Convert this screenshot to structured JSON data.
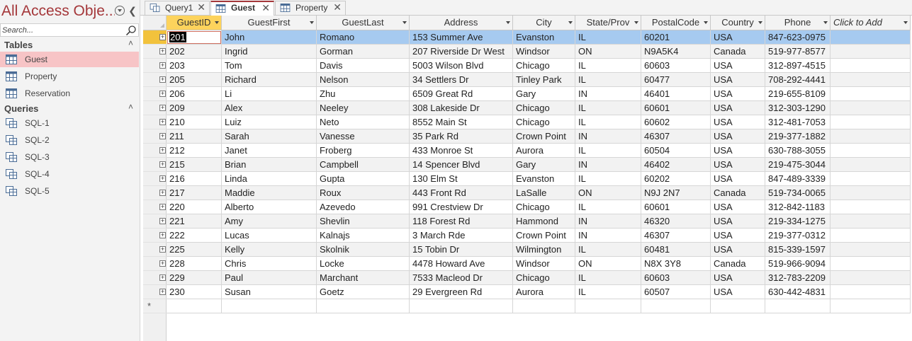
{
  "nav": {
    "title": "All Access Obje...",
    "search_placeholder": "Search...",
    "groups": [
      {
        "label": "Tables",
        "items": [
          {
            "label": "Guest"
          },
          {
            "label": "Property"
          },
          {
            "label": "Reservation"
          }
        ]
      },
      {
        "label": "Queries",
        "items": [
          {
            "label": "SQL-1"
          },
          {
            "label": "SQL-2"
          },
          {
            "label": "SQL-3"
          },
          {
            "label": "SQL-4"
          },
          {
            "label": "SQL-5"
          }
        ]
      }
    ]
  },
  "tabs": [
    {
      "label": "Query1"
    },
    {
      "label": "Guest"
    },
    {
      "label": "Property"
    }
  ],
  "columns": [
    "GuestID",
    "GuestFirst",
    "GuestLast",
    "Address",
    "City",
    "State/Prov",
    "PostalCode",
    "Country",
    "Phone",
    "Click to Add"
  ],
  "rows": [
    [
      "201",
      "John",
      "Romano",
      "153 Summer Ave",
      "Evanston",
      "IL",
      "60201",
      "USA",
      "847-623-0975"
    ],
    [
      "202",
      "Ingrid",
      "Gorman",
      "207 Riverside Dr West",
      "Windsor",
      "ON",
      "N9A5K4",
      "Canada",
      "519-977-8577"
    ],
    [
      "203",
      "Tom",
      "Davis",
      "5003 Wilson Blvd",
      "Chicago",
      "IL",
      "60603",
      "USA",
      "312-897-4515"
    ],
    [
      "205",
      "Richard",
      "Nelson",
      "34 Settlers Dr",
      "Tinley Park",
      "IL",
      "60477",
      "USA",
      "708-292-4441"
    ],
    [
      "206",
      "Li",
      "Zhu",
      "6509 Great Rd",
      "Gary",
      "IN",
      "46401",
      "USA",
      "219-655-8109"
    ],
    [
      "209",
      "Alex",
      "Neeley",
      "308 Lakeside Dr",
      "Chicago",
      "IL",
      "60601",
      "USA",
      "312-303-1290"
    ],
    [
      "210",
      "Luiz",
      "Neto",
      "8552 Main St",
      "Chicago",
      "IL",
      "60602",
      "USA",
      "312-481-7053"
    ],
    [
      "211",
      "Sarah",
      "Vanesse",
      "35 Park Rd",
      "Crown Point",
      "IN",
      "46307",
      "USA",
      "219-377-1882"
    ],
    [
      "212",
      "Janet",
      "Froberg",
      "433 Monroe St",
      "Aurora",
      "IL",
      "60504",
      "USA",
      "630-788-3055"
    ],
    [
      "215",
      "Brian",
      "Campbell",
      "14 Spencer Blvd",
      "Gary",
      "IN",
      "46402",
      "USA",
      "219-475-3044"
    ],
    [
      "216",
      "Linda",
      "Gupta",
      "130 Elm St",
      "Evanston",
      "IL",
      "60202",
      "USA",
      "847-489-3339"
    ],
    [
      "217",
      "Maddie",
      "Roux",
      "443 Front Rd",
      "LaSalle",
      "ON",
      "N9J 2N7",
      "Canada",
      "519-734-0065"
    ],
    [
      "220",
      "Alberto",
      "Azevedo",
      "991 Crestview Dr",
      "Chicago",
      "IL",
      "60601",
      "USA",
      "312-842-1183"
    ],
    [
      "221",
      "Amy",
      "Shevlin",
      "118 Forest Rd",
      "Hammond",
      "IN",
      "46320",
      "USA",
      "219-334-1275"
    ],
    [
      "222",
      "Lucas",
      "Kalnajs",
      "3 March Rde",
      "Crown Point",
      "IN",
      "46307",
      "USA",
      "219-377-0312"
    ],
    [
      "225",
      "Kelly",
      "Skolnik",
      "15 Tobin Dr",
      "Wilmington",
      "IL",
      "60481",
      "USA",
      "815-339-1597"
    ],
    [
      "228",
      "Chris",
      "Locke",
      "4478 Howard Ave",
      "Windsor",
      "ON",
      "N8X 3Y8",
      "Canada",
      "519-966-9094"
    ],
    [
      "229",
      "Paul",
      "Marchant",
      "7533 Macleod Dr",
      "Chicago",
      "IL",
      "60603",
      "USA",
      "312-783-2209"
    ],
    [
      "230",
      "Susan",
      "Goetz",
      "29 Evergreen Rd",
      "Aurora",
      "IL",
      "60507",
      "USA",
      "630-442-4831"
    ]
  ],
  "new_row_marker": "*",
  "colors": {
    "accent": "#a4373a",
    "selected_nav": "#f7c4c6",
    "selected_row": "#a6caf0",
    "sorted_header": "#fdd35c"
  }
}
